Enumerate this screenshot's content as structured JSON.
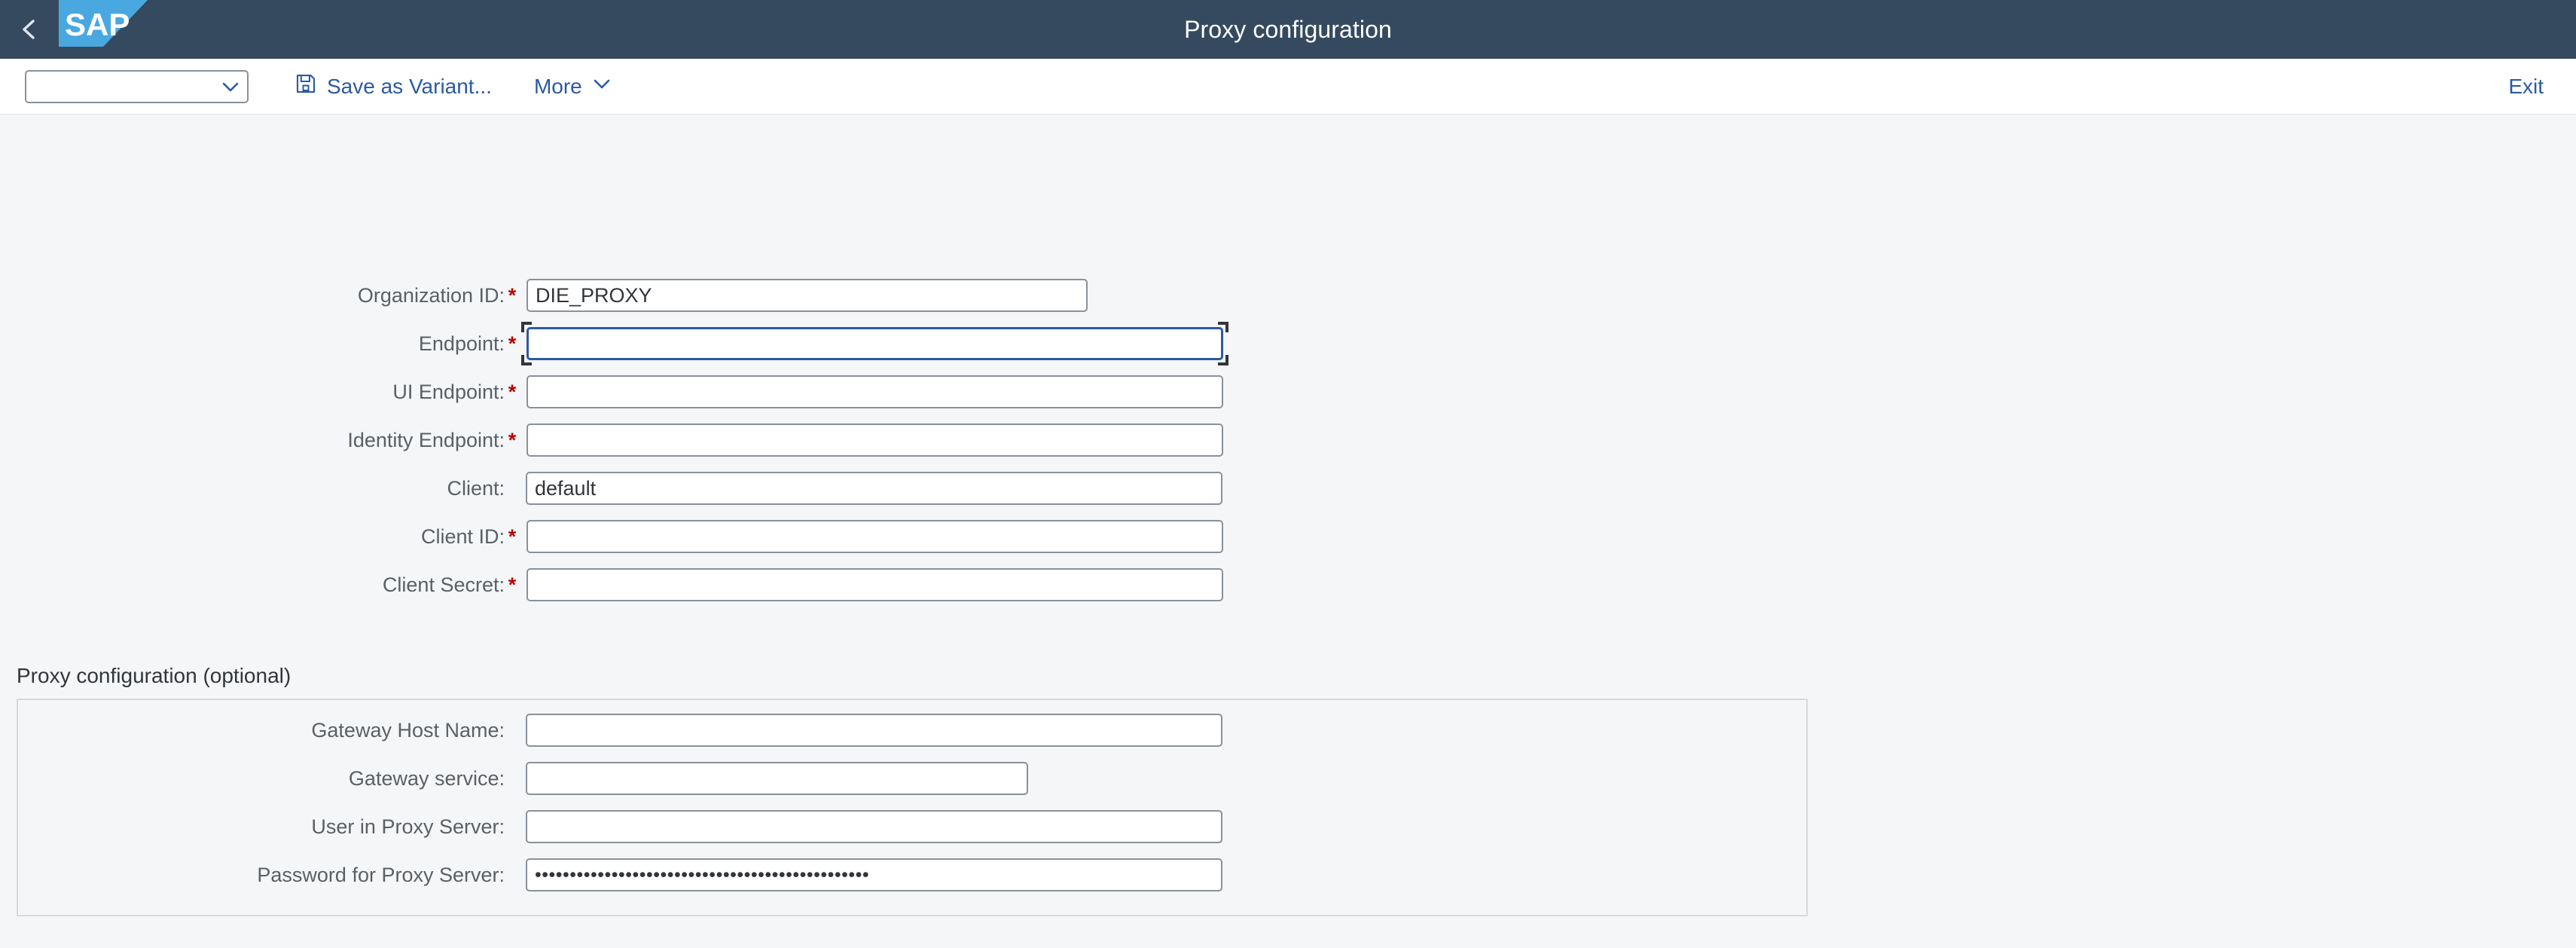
{
  "header": {
    "back_icon": "chevron-left-icon",
    "logo_text": "SAP",
    "title": "Proxy configuration",
    "bg_color": "#354a5f",
    "logo_color": "#4aa8e0"
  },
  "toolbar": {
    "variant_select": {
      "value": "",
      "placeholder": "",
      "icon": "chevron-down-icon"
    },
    "save_variant": {
      "label": "Save as Variant...",
      "icon": "save-floppy-icon"
    },
    "more": {
      "label": "More",
      "icon": "chevron-down-icon"
    },
    "exit": {
      "label": "Exit"
    },
    "accent_color": "#2b5aa0"
  },
  "form": {
    "required_marker": "*",
    "fields": [
      {
        "label": "Organization ID:",
        "required": true,
        "value": "DIE_PROXY",
        "focused": false
      },
      {
        "label": "Endpoint:",
        "required": true,
        "value": "",
        "focused": true
      },
      {
        "label": "UI Endpoint:",
        "required": true,
        "value": "",
        "focused": false
      },
      {
        "label": "Identity Endpoint:",
        "required": true,
        "value": "",
        "focused": false
      },
      {
        "label": "Client:",
        "required": false,
        "value": "default",
        "focused": false
      },
      {
        "label": "Client ID:",
        "required": true,
        "value": "",
        "focused": false
      },
      {
        "label": "Client Secret:",
        "required": true,
        "value": "",
        "focused": false
      }
    ]
  },
  "optional_section": {
    "title": "Proxy configuration (optional)",
    "fields": [
      {
        "label": "Gateway Host Name:",
        "required": false,
        "value": ""
      },
      {
        "label": "Gateway service:",
        "required": false,
        "value": ""
      },
      {
        "label": "User in Proxy Server:",
        "required": false,
        "value": ""
      },
      {
        "label": "Password for Proxy Server:",
        "required": false,
        "masked": true,
        "value": "••••••••••••••••••••••••••••••••••••••••••••••••"
      }
    ]
  }
}
